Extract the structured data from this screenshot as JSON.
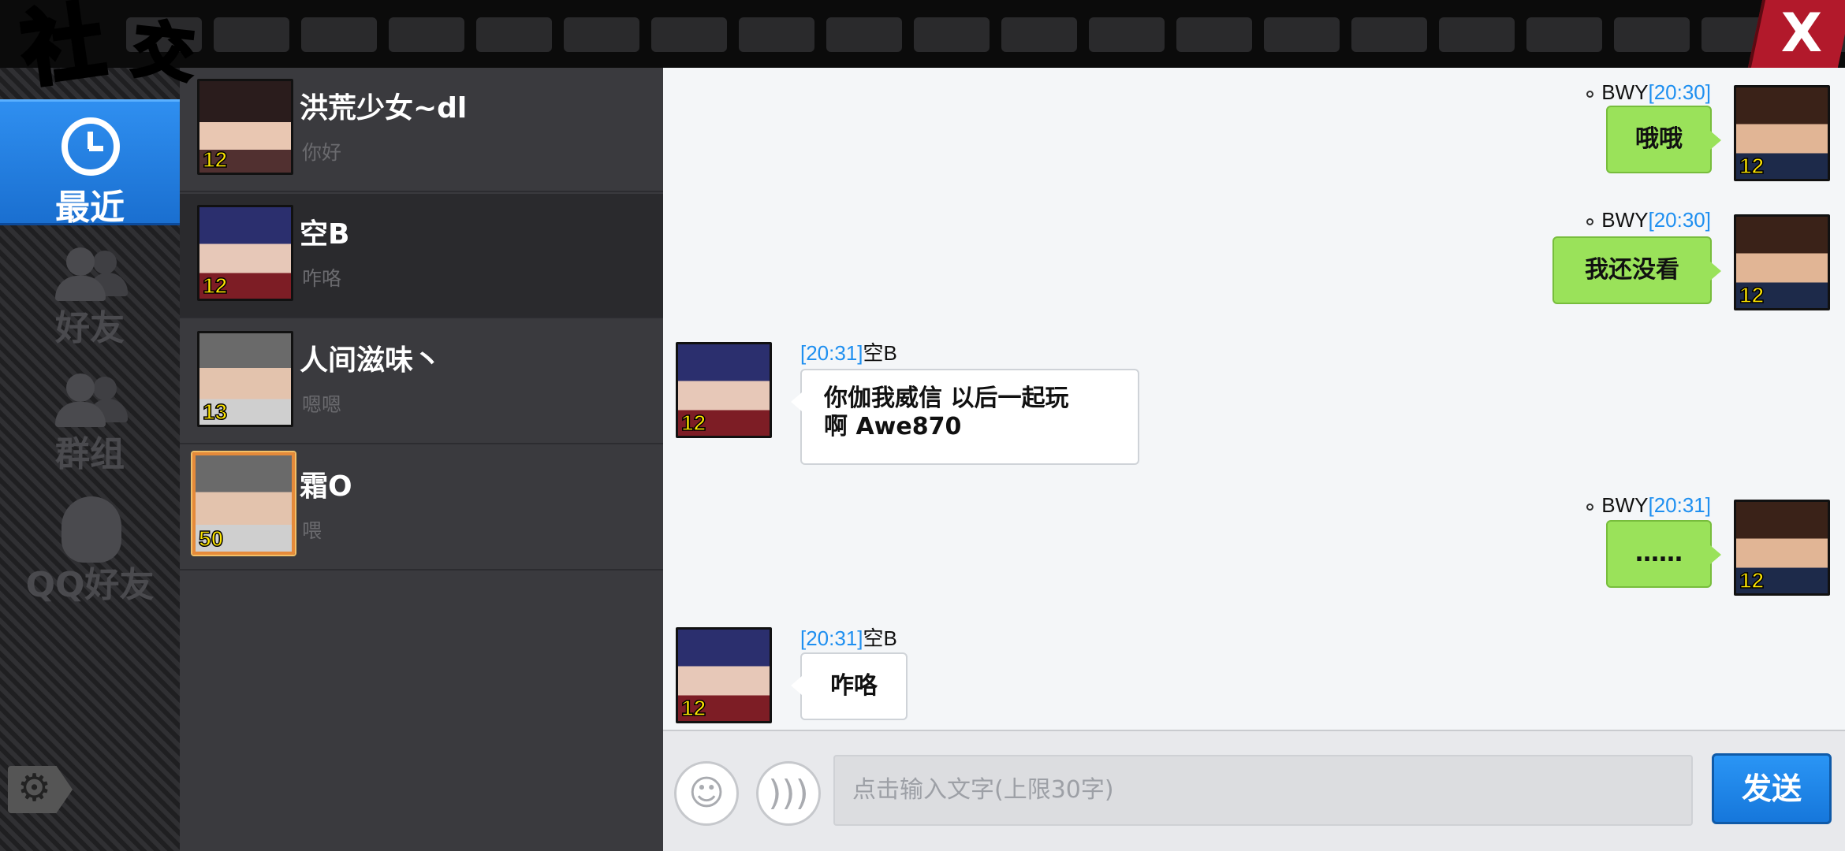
{
  "app": {
    "title_char1": "社",
    "title_char2": "交",
    "close_label": "X"
  },
  "nav": {
    "recent": "最近",
    "friends": "好友",
    "groups": "群组",
    "qq_friends": "QQ好友"
  },
  "friends": [
    {
      "name": "洪荒少女~dl",
      "last_message": "你好",
      "level": "12"
    },
    {
      "name": "空B",
      "last_message": "咋咯",
      "level": "12"
    },
    {
      "name": "人间滋味丶",
      "last_message": "嗯嗯",
      "level": "13"
    },
    {
      "name": "霜O",
      "last_message": "喂",
      "level": "50"
    }
  ],
  "messages": [
    {
      "sender": "BWY",
      "time": "[20:30]",
      "text": "哦哦",
      "level": "12",
      "side": "right"
    },
    {
      "sender": "BWY",
      "time": "[20:30]",
      "text": "我还没看",
      "level": "12",
      "side": "right"
    },
    {
      "sender": "空B",
      "time": "[20:31]",
      "text_line1": "你伽我威信 以后一起玩",
      "text_line2": "啊  Awe870",
      "level": "12",
      "side": "left"
    },
    {
      "sender": "BWY",
      "time": "[20:31]",
      "text": "……",
      "level": "12",
      "side": "right"
    },
    {
      "sender": "空B",
      "time": "[20:31]",
      "text": "咋咯",
      "level": "12",
      "side": "left"
    }
  ],
  "input": {
    "placeholder": "点击输入文字(上限30字)",
    "send_label": "发送"
  },
  "colors": {
    "accent_blue": "#1e8ff0",
    "bubble_green": "#9ae25a",
    "title_yellow": "#ffe600",
    "close_red": "#b2192b"
  }
}
